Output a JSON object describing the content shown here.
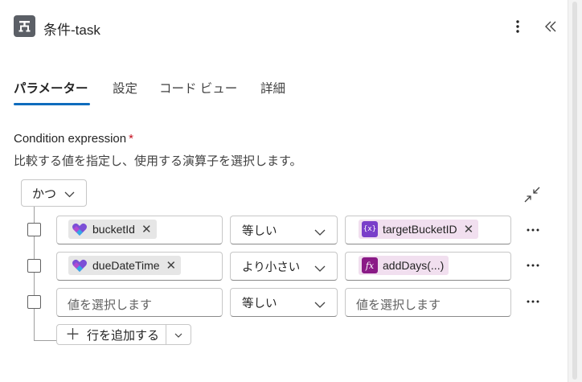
{
  "header": {
    "title": "条件-task",
    "icon": "condition-icon"
  },
  "tabs": [
    {
      "label": "パラメーター",
      "active": true
    },
    {
      "label": "設定",
      "active": false
    },
    {
      "label": "コード ビュー",
      "active": false
    },
    {
      "label": "詳細",
      "active": false
    }
  ],
  "condition": {
    "label": "Condition expression",
    "required_mark": "*",
    "description": "比較する値を指定し、使用する演算子を選択します。",
    "group_operator": "かつ",
    "rows": [
      {
        "left_token": "bucketId",
        "left_icon": "planner-icon",
        "operator": "等しい",
        "right_token": "targetBucketID",
        "right_icon": "variable-icon"
      },
      {
        "left_token": "dueDateTime",
        "left_icon": "planner-icon",
        "operator": "より小さい",
        "right_token": "addDays(...)",
        "right_icon": "function-icon"
      },
      {
        "left_placeholder": "値を選択します",
        "operator": "等しい",
        "right_placeholder": "値を選択します"
      }
    ],
    "add_row_label": "行を追加する"
  },
  "colors": {
    "accent": "#0f6cbd",
    "required": "#c50f1f",
    "variable": "#7a3ec9",
    "function": "#8a1a86"
  }
}
